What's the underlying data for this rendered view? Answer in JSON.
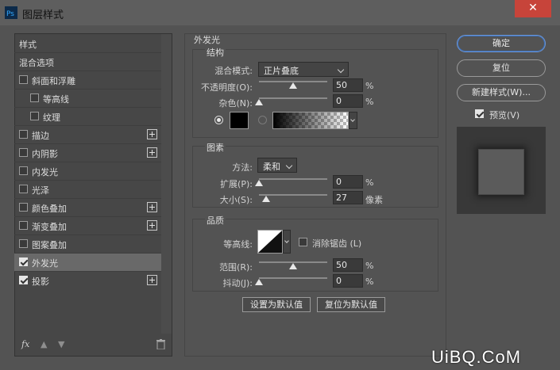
{
  "window": {
    "title": "图层样式",
    "close_label": "✕"
  },
  "left_panel": {
    "items": [
      {
        "label": "样式",
        "has_checkbox": false,
        "checked": false,
        "has_plus": false,
        "selected": false
      },
      {
        "label": "混合选项",
        "has_checkbox": false,
        "checked": false,
        "has_plus": false,
        "selected": false
      },
      {
        "label": "斜面和浮雕",
        "has_checkbox": true,
        "checked": false,
        "has_plus": false,
        "selected": false
      },
      {
        "label": "等高线",
        "has_checkbox": true,
        "checked": false,
        "has_plus": false,
        "selected": false
      },
      {
        "label": "纹理",
        "has_checkbox": true,
        "checked": false,
        "has_plus": false,
        "selected": false
      },
      {
        "label": "描边",
        "has_checkbox": true,
        "checked": false,
        "has_plus": true,
        "selected": false
      },
      {
        "label": "内阴影",
        "has_checkbox": true,
        "checked": false,
        "has_plus": true,
        "selected": false
      },
      {
        "label": "内发光",
        "has_checkbox": true,
        "checked": false,
        "has_plus": false,
        "selected": false
      },
      {
        "label": "光泽",
        "has_checkbox": true,
        "checked": false,
        "has_plus": false,
        "selected": false
      },
      {
        "label": "颜色叠加",
        "has_checkbox": true,
        "checked": false,
        "has_plus": true,
        "selected": false
      },
      {
        "label": "渐变叠加",
        "has_checkbox": true,
        "checked": false,
        "has_plus": true,
        "selected": false
      },
      {
        "label": "图案叠加",
        "has_checkbox": true,
        "checked": false,
        "has_plus": false,
        "selected": false
      },
      {
        "label": "外发光",
        "has_checkbox": true,
        "checked": true,
        "has_plus": false,
        "selected": true
      },
      {
        "label": "投影",
        "has_checkbox": true,
        "checked": true,
        "has_plus": true,
        "selected": false
      }
    ],
    "footer": {
      "fx_label": "fx"
    }
  },
  "outer_glow": {
    "title": "外发光",
    "structure": {
      "title": "结构",
      "blend_mode_label": "混合模式:",
      "blend_mode_value": "正片叠底",
      "opacity_label": "不透明度(O):",
      "opacity_value": "50",
      "opacity_unit": "%",
      "noise_label": "杂色(N):",
      "noise_value": "0",
      "noise_unit": "%",
      "glow_color": "#000000"
    },
    "elements": {
      "title": "图素",
      "technique_label": "方法:",
      "technique_value": "柔和",
      "spread_label": "扩展(P):",
      "spread_value": "0",
      "spread_unit": "%",
      "size_label": "大小(S):",
      "size_value": "27",
      "size_unit": "像素"
    },
    "quality": {
      "title": "品质",
      "contour_label": "等高线:",
      "antialias_label": "消除锯齿 (L)",
      "antialias_checked": false,
      "range_label": "范围(R):",
      "range_value": "50",
      "range_unit": "%",
      "jitter_label": "抖动(J):",
      "jitter_value": "0",
      "jitter_unit": "%"
    },
    "make_default_label": "设置为默认值",
    "reset_default_label": "复位为默认值"
  },
  "right_panel": {
    "ok_label": "确定",
    "reset_label": "复位",
    "new_style_label": "新建样式(W)...",
    "preview_label": "预览(V)",
    "preview_checked": true
  },
  "watermark": "UiBQ.CoM",
  "colors": {
    "accent": "#6e97d6",
    "close": "#c7443a",
    "selected_row": "#696969"
  }
}
